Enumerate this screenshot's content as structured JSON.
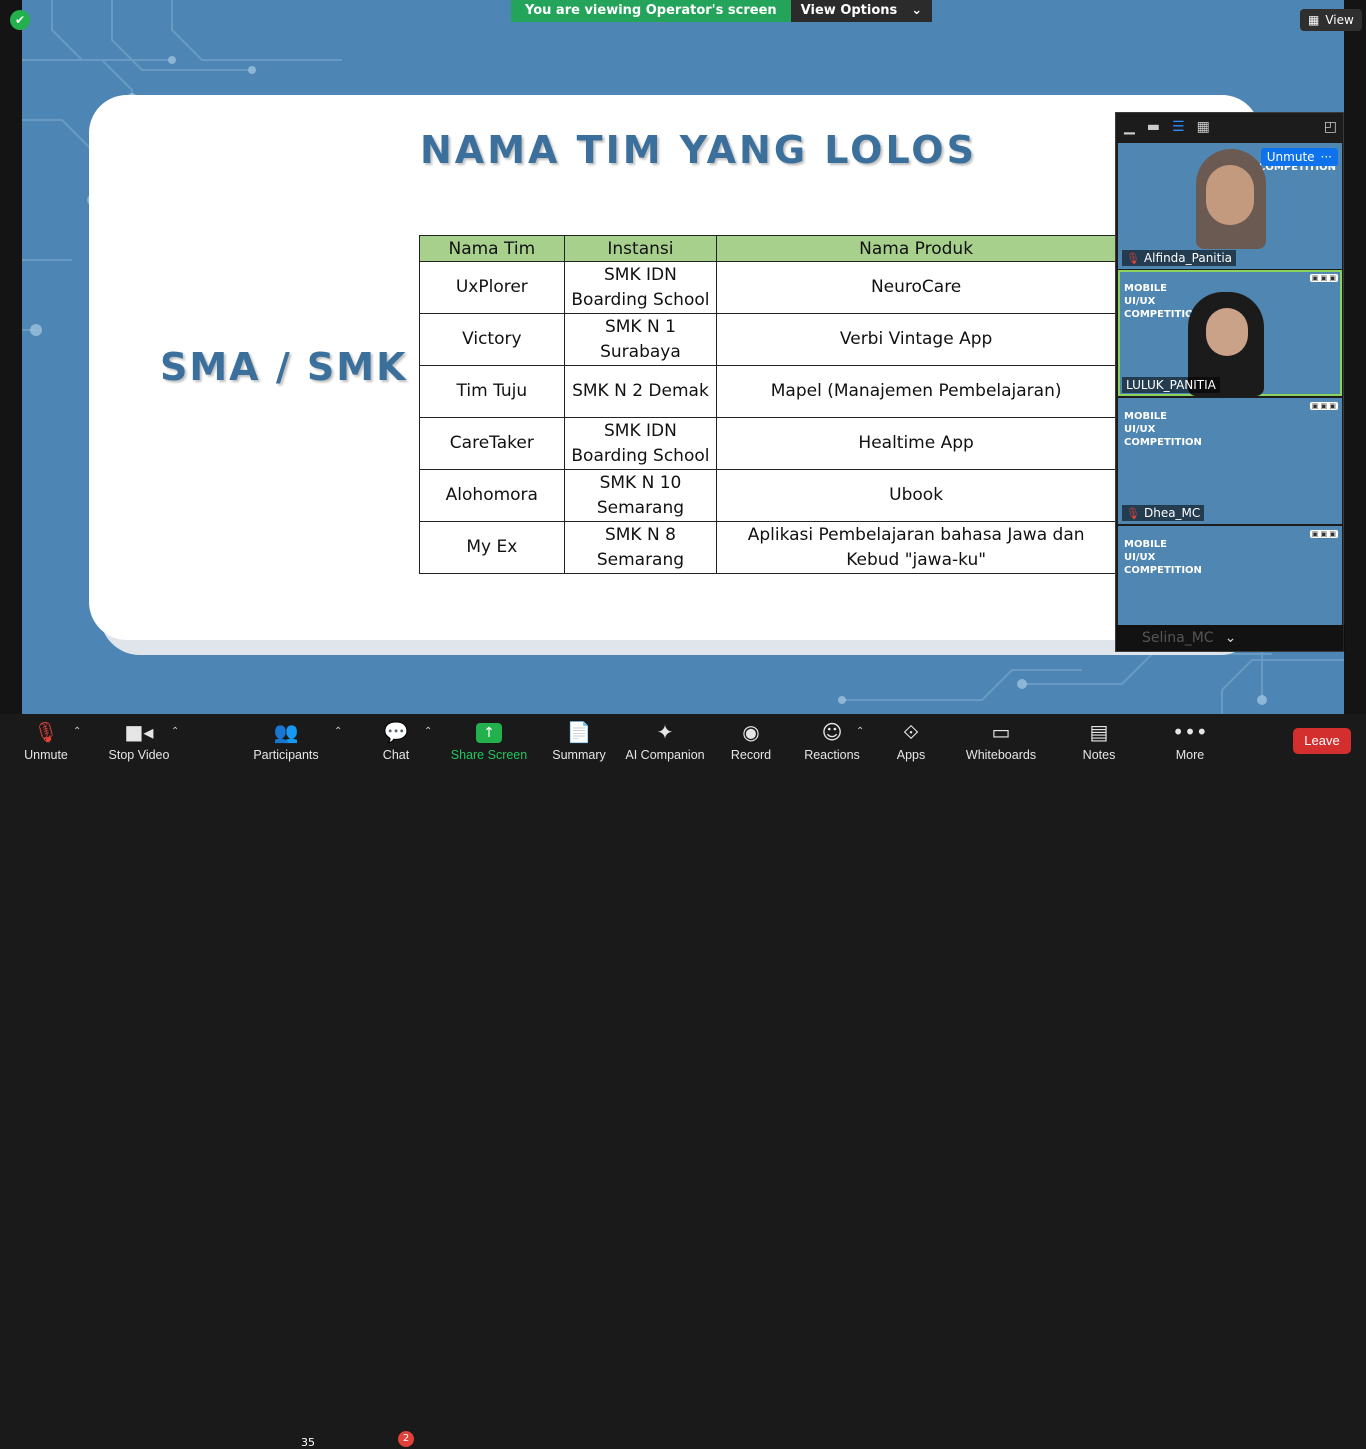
{
  "banner": {
    "viewing_text": "You are viewing Operator's screen",
    "view_options_label": "View Options"
  },
  "view_button": {
    "label": "View"
  },
  "slide": {
    "title": "NAMA TIM YANG LOLOS",
    "category": "SMA / SMK",
    "table": {
      "headers": [
        "Nama Tim",
        "Instansi",
        "Nama Produk"
      ],
      "rows": [
        [
          "UxPlorer",
          "SMK IDN Boarding School",
          "NeuroCare"
        ],
        [
          "Victory",
          "SMK N 1 Surabaya",
          "Verbi Vintage App"
        ],
        [
          "Tim Tuju",
          "SMK N 2 Demak",
          "Mapel (Manajemen Pembelajaran)"
        ],
        [
          "CareTaker",
          "SMK IDN Boarding School",
          "Healtime App"
        ],
        [
          "Alohomora",
          "SMK N 10 Semarang",
          "Ubook"
        ],
        [
          "My Ex",
          "SMK N 8 Semarang",
          "Aplikasi Pembelajaran bahasa Jawa dan Kebud \"jawa-ku\""
        ]
      ]
    }
  },
  "participants_panel": {
    "tiles": [
      {
        "name": "Alfinda_Panitia",
        "muted": true,
        "slide_text": "UI/UX COMPETITION",
        "badge": "Unmute"
      },
      {
        "name": "LULUK_PANITIA",
        "muted": false,
        "slide_text": "MOBILE UI/UX COMPETITION"
      },
      {
        "name": "Dhea_MC",
        "muted": true,
        "slide_text": "MOBILE UI/UX COMPETITION"
      },
      {
        "name": "Selina_MC",
        "muted": false,
        "slide_text": "MOBILE UI/UX COMPETITION"
      }
    ]
  },
  "toolbar": {
    "unmute": "Unmute",
    "stop_video": "Stop Video",
    "participants": "Participants",
    "participants_count": "35",
    "chat": "Chat",
    "chat_badge": "2",
    "share_screen": "Share Screen",
    "summary": "Summary",
    "ai_companion": "AI Companion",
    "record": "Record",
    "reactions": "Reactions",
    "apps": "Apps",
    "whiteboards": "Whiteboards",
    "notes": "Notes",
    "more": "More",
    "leave": "Leave"
  },
  "colors": {
    "share_green": "#22b14c",
    "leave_red": "#d32f2f",
    "slide_blue": "#4d86b4",
    "table_header_green": "#a8d08d"
  }
}
